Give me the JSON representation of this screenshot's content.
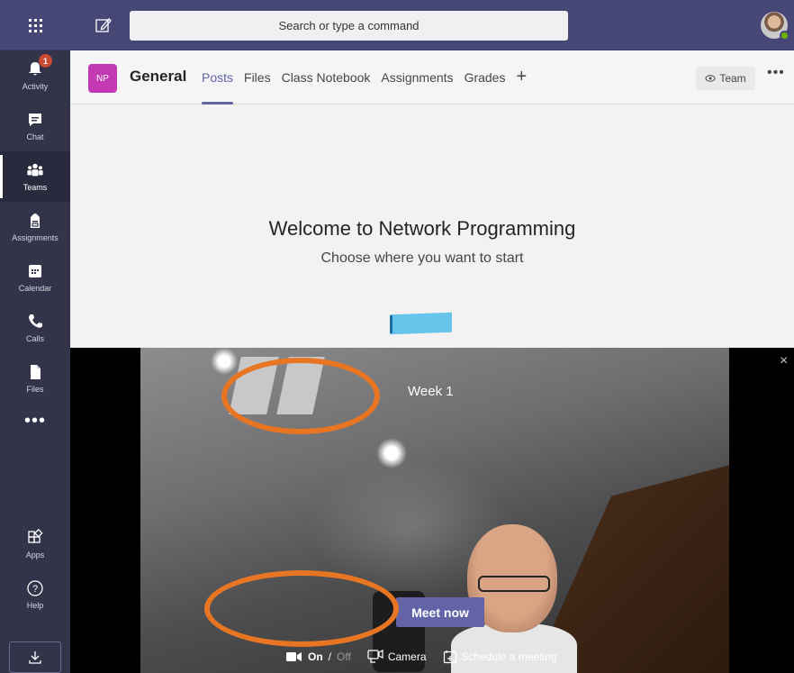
{
  "topbar": {
    "search_placeholder": "Search or type a command"
  },
  "rail": {
    "items": [
      {
        "label": "Activity",
        "badge": "1"
      },
      {
        "label": "Chat"
      },
      {
        "label": "Teams"
      },
      {
        "label": "Assignments"
      },
      {
        "label": "Calendar"
      },
      {
        "label": "Calls"
      },
      {
        "label": "Files"
      },
      {
        "label": "Apps"
      },
      {
        "label": "Help"
      }
    ],
    "more": "•••"
  },
  "channel": {
    "avatar": "NP",
    "name": "General",
    "tabs": [
      "Posts",
      "Files",
      "Class Notebook",
      "Assignments",
      "Grades"
    ],
    "add_tab": "+",
    "team_button": "Team",
    "more": "•••"
  },
  "welcome": {
    "title": "Welcome to Network Programming",
    "subtitle": "Choose where you want to start"
  },
  "video": {
    "title": "Week 1",
    "close": "×",
    "meet_now": "Meet now",
    "video_on": "On",
    "separator": "/",
    "video_off": "Off",
    "camera": "Camera",
    "schedule": "Schedule a meeting"
  },
  "colors": {
    "brand": "#6264a7",
    "rail": "#33344a",
    "topbar": "#464775",
    "annotation": "#e87522"
  }
}
